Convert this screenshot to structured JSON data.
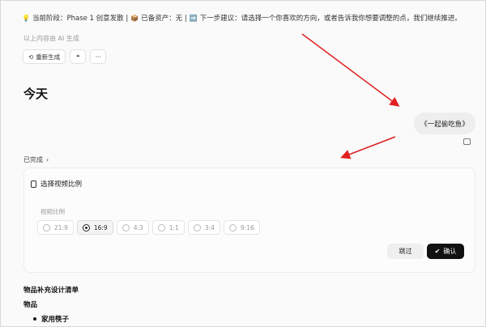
{
  "status": {
    "bulb_icon": "lightbulb-icon",
    "text_a": "当前阶段：Phase 1 创意发散 | ",
    "box_icon": "package-icon",
    "text_b": " 已备资产：无 | ",
    "arrow_icon": "arrow-right-icon",
    "text_c": " 下一步建议：请选择一个你喜欢的方向，或者告诉我你想要调整的点，我们继续推进。"
  },
  "ai_note": "以上内容由 AI 生成",
  "actions": {
    "regenerate_label": "重新生成",
    "quote_glyph": "❝",
    "more_glyph": "···"
  },
  "today_heading": "今天",
  "user_message": "《一起偷吃鱼》",
  "done_label": "已完成",
  "panel": {
    "title": "选择视频比例",
    "ratio_label": "视频比例",
    "ratios": [
      {
        "label": "21:9",
        "selected": false
      },
      {
        "label": "16:9",
        "selected": true
      },
      {
        "label": "4:3",
        "selected": false
      },
      {
        "label": "1:1",
        "selected": false
      },
      {
        "label": "3:4",
        "selected": false
      },
      {
        "label": "9:16",
        "selected": false
      }
    ],
    "skip_label": "跳过",
    "confirm_label": "确认"
  },
  "list": {
    "title": "物品补充设计清单",
    "subtitle": "物品",
    "items": [
      "家用筷子"
    ]
  },
  "colors": {
    "annotation_arrow": "#e02020",
    "confirm_bg": "#111111"
  }
}
